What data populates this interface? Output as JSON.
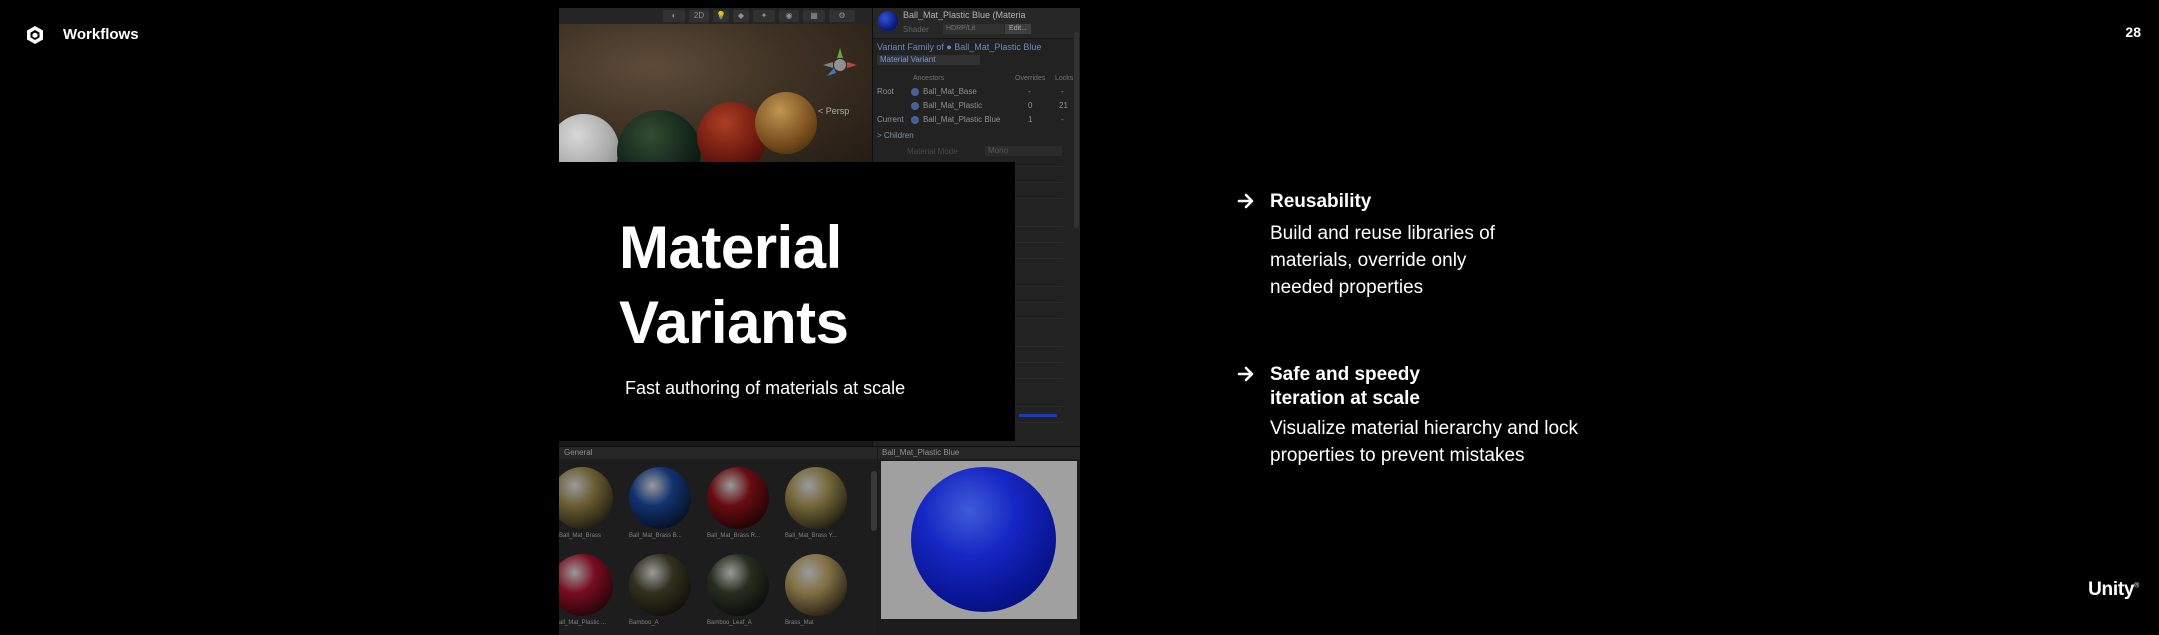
{
  "header": {
    "section": "Workflows",
    "page_number": "28",
    "brand": "Unity"
  },
  "title_card": {
    "title_line1": "Material",
    "title_line2": "Variants",
    "subtitle": "Fast authoring of materials at scale"
  },
  "bullets": [
    {
      "title": "Reusability",
      "desc_lines": [
        "Build and reuse libraries of",
        "materials, override only",
        "needed properties"
      ]
    },
    {
      "title_lines": [
        "Safe and speedy",
        "iteration at scale"
      ],
      "desc_lines": [
        "Visualize material hierarchy and lock",
        "properties to prevent mistakes"
      ]
    }
  ],
  "editor": {
    "scene": {
      "toolbar_mode": "2D",
      "view_label": "< Persp"
    },
    "inspector": {
      "title": "Ball_Mat_Plastic Blue (Materia",
      "shader_label": "Shader",
      "shader_value": "HDRP/Lit",
      "edit_label": "Edit...",
      "variant_family_label": "Variant Family of",
      "variant_family_value": "Ball_Mat_Plastic Blue",
      "variant_dropdown": "Material Variant",
      "hierarchy_headers": {
        "ancestors": "Ancestors",
        "overrides": "Overrides",
        "locks": "Locks"
      },
      "hierarchy_rows": [
        {
          "role": "Root",
          "name": "Ball_Mat_Base",
          "overrides": "-",
          "locks": "-"
        },
        {
          "role": "",
          "name": "Ball_Mat_Plastic",
          "overrides": "0",
          "locks": "21"
        },
        {
          "role": "Current",
          "name": "Ball_Mat_Plastic Blue",
          "overrides": "1",
          "locks": "-"
        }
      ],
      "children_label": "> Children",
      "material_mode_label": "Material Mode",
      "material_mode_value": "Mono"
    },
    "project": {
      "folder": "General",
      "items": [
        {
          "label": "Ball_Mat_Brass",
          "color": "#7d6e3d"
        },
        {
          "label": "Ball_Mat_Brass B...",
          "color": "#163c84"
        },
        {
          "label": "Ball_Mat_Brass R...",
          "color": "#7a0f14"
        },
        {
          "label": "Ball_Mat_Brass Y...",
          "color": "#8a7a45"
        },
        {
          "label": "all_Mat_Plastic ...",
          "color": "#8e1025"
        },
        {
          "label": "Bamboo_A",
          "color": "#3b3a26"
        },
        {
          "label": "Bamboo_Leaf_A",
          "color": "#2f3526"
        },
        {
          "label": "Brass_Mat",
          "color": "#9a8450"
        }
      ]
    },
    "preview": {
      "title": "Ball_Mat_Plastic Blue"
    }
  }
}
